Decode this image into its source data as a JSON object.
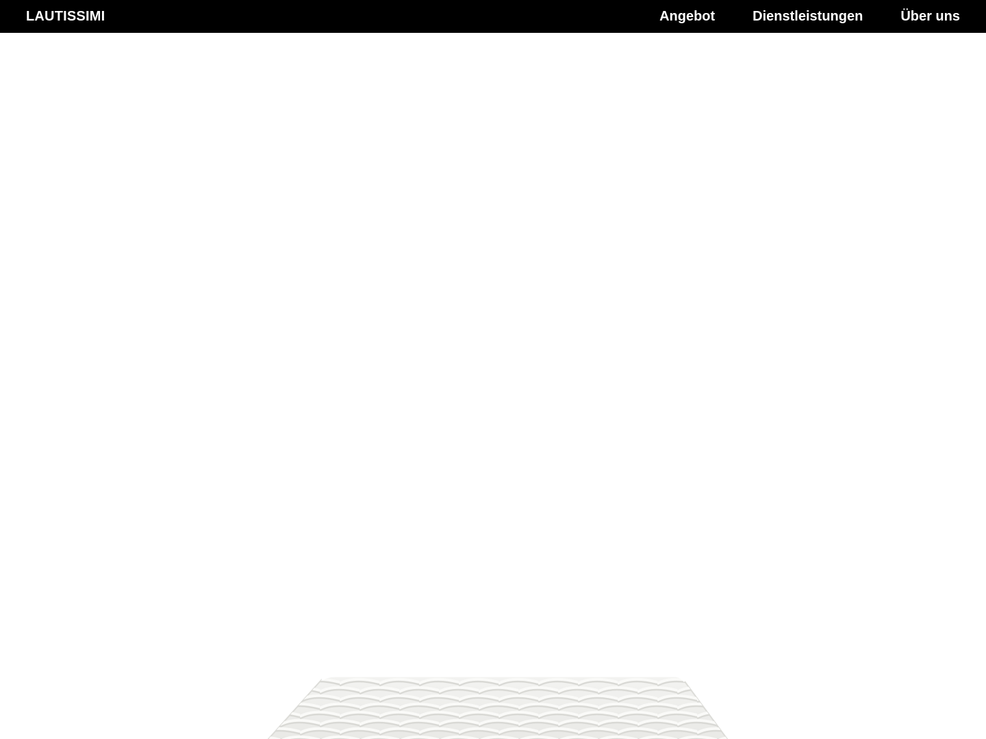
{
  "header": {
    "brand": "LAUTISSIMI",
    "nav": [
      {
        "label": "Angebot"
      },
      {
        "label": "Dienstleistungen"
      },
      {
        "label": "Über uns"
      }
    ]
  },
  "colors": {
    "header_bg": "#000000",
    "header_text": "#ffffff",
    "page_bg": "#ffffff",
    "product_top": "#ededeb",
    "product_quilt_light": "#fafaf8",
    "product_quilt_shadow": "#d9d9d5"
  },
  "hero": {
    "image": "mattress-product-image"
  }
}
